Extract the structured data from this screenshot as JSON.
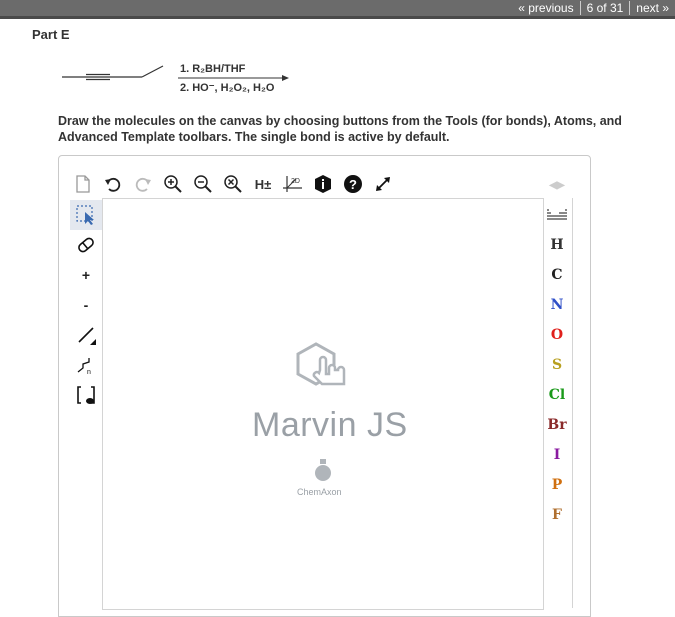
{
  "nav": {
    "previous": "« previous",
    "position": "6 of 31",
    "next": "next »"
  },
  "part": {
    "title": "Part E"
  },
  "reaction": {
    "step1": "1. R₂BH/THF",
    "step2": "2. HO⁻, H₂O₂, H₂O"
  },
  "instructions": "Draw the molecules on the canvas by choosing buttons from the Tools (for bonds), Atoms, and Advanced Template toolbars. The single bond is active by default.",
  "editor": {
    "top_tools": [
      {
        "name": "new-document-icon"
      },
      {
        "name": "undo-icon"
      },
      {
        "name": "redo-icon"
      },
      {
        "name": "zoom-in-icon"
      },
      {
        "name": "zoom-out-icon"
      },
      {
        "name": "clear-icon"
      },
      {
        "name": "h-toggle",
        "label": "H±"
      },
      {
        "name": "2d-clean-icon",
        "label": "2D"
      },
      {
        "name": "info-icon"
      },
      {
        "name": "help-icon"
      },
      {
        "name": "fullscreen-icon"
      }
    ],
    "left_tools": [
      {
        "name": "select-tool",
        "label": ""
      },
      {
        "name": "erase-tool",
        "label": ""
      },
      {
        "name": "plus-charge-tool",
        "label": "+"
      },
      {
        "name": "minus-charge-tool",
        "label": "-"
      },
      {
        "name": "single-bond-tool",
        "label": ""
      },
      {
        "name": "chain-tool",
        "label": ""
      },
      {
        "name": "bracket-tool",
        "label": ""
      }
    ],
    "atoms": [
      {
        "symbol": "H",
        "color": "#333333"
      },
      {
        "symbol": "C",
        "color": "#222222"
      },
      {
        "symbol": "N",
        "color": "#3050c8"
      },
      {
        "symbol": "O",
        "color": "#e0201c"
      },
      {
        "symbol": "S",
        "color": "#b8a020"
      },
      {
        "symbol": "Cl",
        "color": "#1a9a1a"
      },
      {
        "symbol": "Br",
        "color": "#8a2a2a"
      },
      {
        "symbol": "I",
        "color": "#8a1aa0"
      },
      {
        "symbol": "P",
        "color": "#d07010"
      },
      {
        "symbol": "F",
        "color": "#b07030"
      }
    ],
    "logo": "Marvin JS",
    "brand": "ChemAxon"
  }
}
